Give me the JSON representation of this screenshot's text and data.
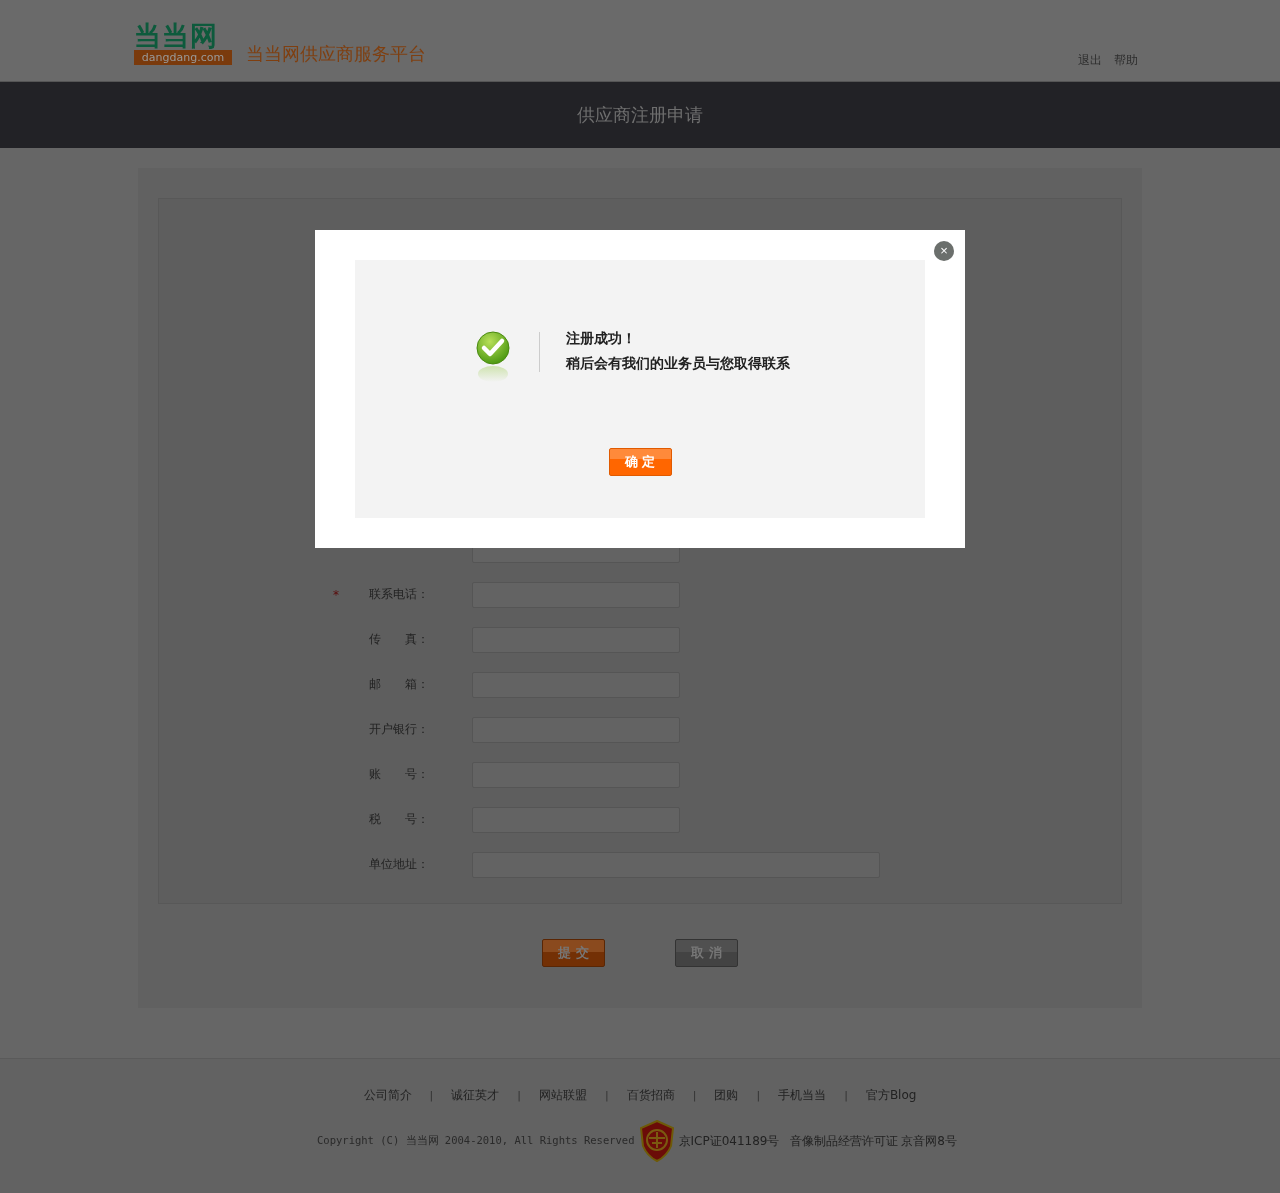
{
  "header": {
    "logo_mark": "当当网",
    "logo_domain": "dangdang.com",
    "platform_title": "当当网供应商服务平台",
    "links": [
      "退出",
      "帮助"
    ]
  },
  "banner": {
    "title": "供应商注册申请"
  },
  "form": {
    "rows": [
      {
        "wide": false
      },
      {
        "label": "联系电话：",
        "required": true,
        "wide": false
      },
      {
        "label": "传　　真：",
        "required": false,
        "wide": false
      },
      {
        "label": "邮　　箱：",
        "required": false,
        "wide": false
      },
      {
        "label": "开户银行：",
        "required": false,
        "wide": false
      },
      {
        "label": "账　　号：",
        "required": false,
        "wide": false
      },
      {
        "label": "税　　号：",
        "required": false,
        "wide": false
      },
      {
        "label": "单位地址：",
        "required": false,
        "wide": true
      }
    ],
    "required_mark": "*",
    "buttons": [
      {
        "label": "提 交",
        "kind": "primary"
      },
      {
        "label": "取 消",
        "kind": "secondary"
      }
    ]
  },
  "dialog": {
    "title": "注册成功！",
    "message": "稍后会有我们的业务员与您取得联系",
    "close": "×",
    "ok_button": "确 定"
  },
  "footer": {
    "links": [
      "公司简介",
      "诚征英才",
      "网站联盟",
      "百货招商",
      "团购",
      "手机当当",
      "官方Blog"
    ],
    "separator": "|",
    "copyright": "Copyright (C) 当当网 2004-2010, All Rights Reserved",
    "licenses": [
      "京ICP证041189号",
      "音像制品经营许可证 京音网8号"
    ]
  }
}
